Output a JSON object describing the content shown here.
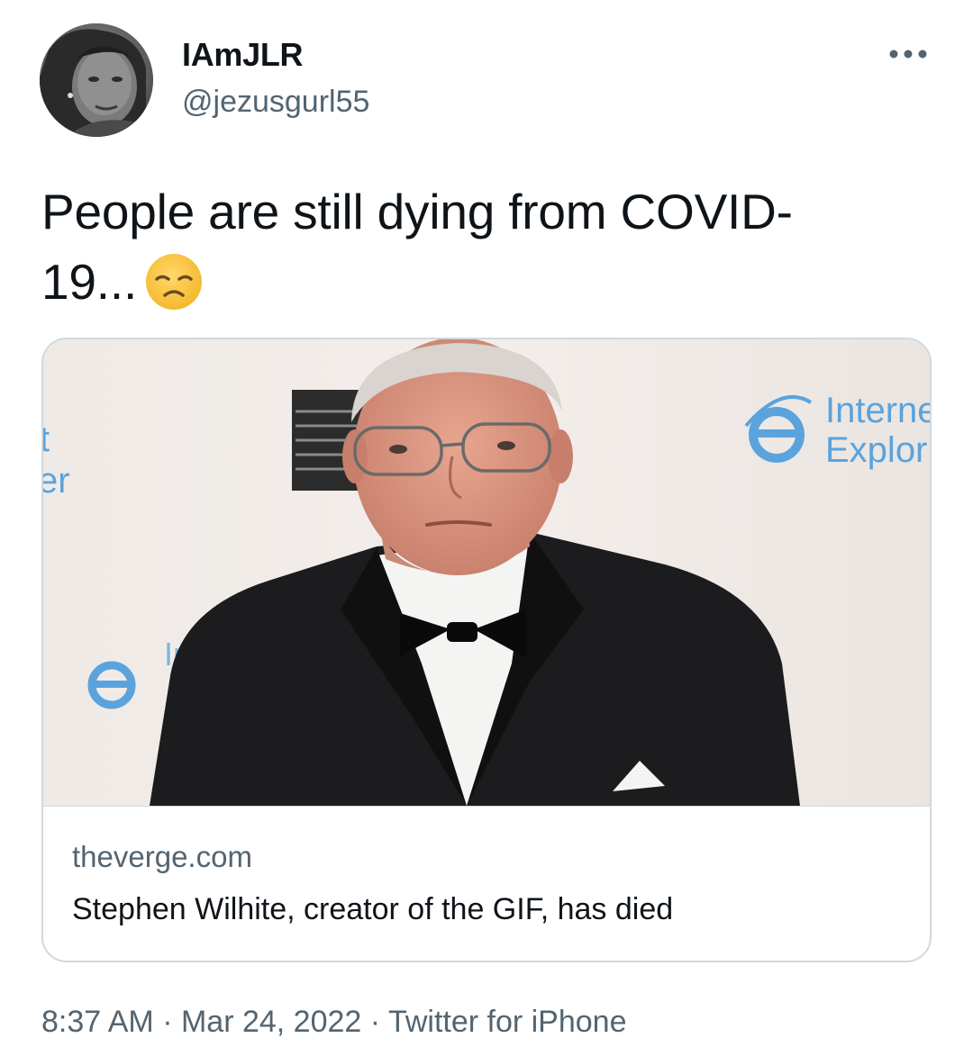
{
  "author": {
    "display_name": "IAmJLR",
    "handle": "@jezusgurl55",
    "avatar_icon": "profile-photo"
  },
  "tweet": {
    "text_line1": "People are still dying from COVID-",
    "text_line2": "19...",
    "emoji_icon": "disappointed-face-emoji"
  },
  "more_icon": "more-options-icon",
  "card": {
    "domain": "theverge.com",
    "title": "Stephen Wilhite, creator of the GIF, has died",
    "image_icon": "portrait-photo",
    "backdrop_text_top": "Interne",
    "backdrop_text_bottom": "Explor",
    "backdrop_text_left_top": "t",
    "backdrop_text_left_bottom": "er",
    "backdrop_text_mid": "Int"
  },
  "footer": {
    "time": "8:37 AM",
    "separator1": " · ",
    "date": "Mar 24, 2022",
    "separator2": " · ",
    "source": "Twitter for iPhone"
  },
  "colors": {
    "text_primary": "#0f1419",
    "text_secondary": "#536471",
    "card_border": "#cfd9de",
    "ie_blue": "#5aa3dd"
  }
}
